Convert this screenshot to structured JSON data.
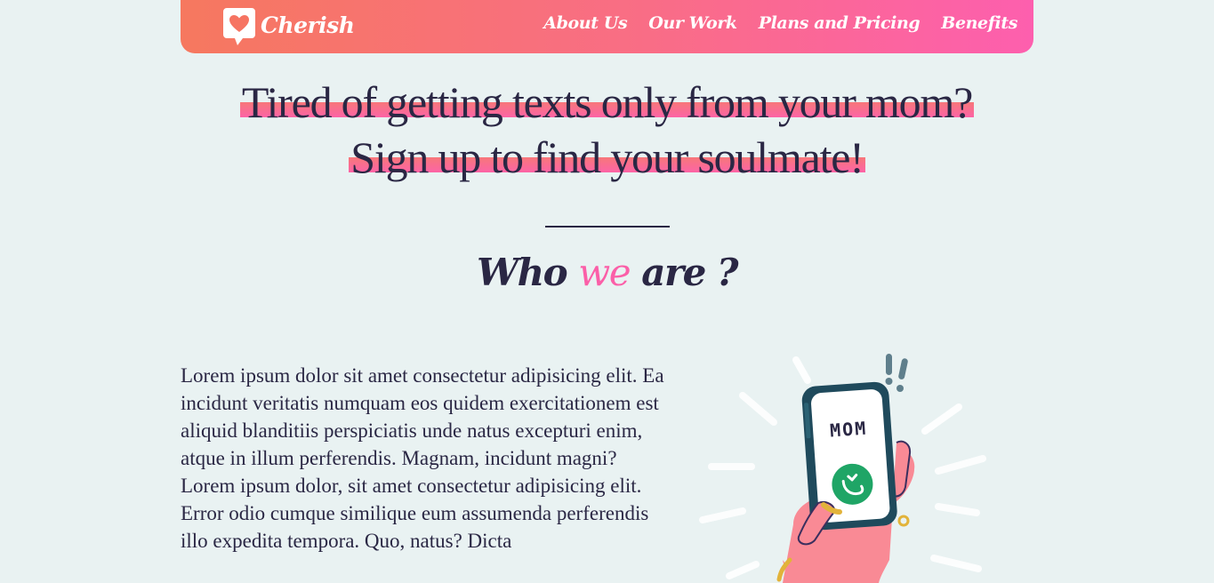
{
  "nav": {
    "brand": "Cherish",
    "links": [
      "About Us",
      "Our Work",
      "Plans and Pricing",
      "Benefits"
    ]
  },
  "hero": {
    "line1": "Tired of getting texts only from your mom?",
    "line2": "Sign up to find your soulmate!"
  },
  "section": {
    "title_pre": "Who",
    "title_accent": "we",
    "title_post": "are ?"
  },
  "about": {
    "paragraph1": "Lorem ipsum dolor sit amet consectetur adipisicing elit. Ea incidunt veritatis numquam eos quidem exercitationem est aliquid blanditiis perspiciatis unde natus excepturi enim, atque in illum perferendis. Magnam, incidunt magni?",
    "paragraph2": "Lorem ipsum dolor, sit amet consectetur adipisicing elit. Error odio cumque similique eum assumenda perferendis illo expedita tempora. Quo, natus? Dicta",
    "phone_caller": "MOM"
  },
  "colors": {
    "background": "#e9f2f2",
    "nav_gradient_start": "#f6785f",
    "nav_gradient_end": "#fd5fae",
    "text_dark": "#2a2744",
    "accent_pink": "#fb5fa8"
  },
  "icons": {
    "logo": "heart-chat-bubble-icon",
    "answer": "phone-answer-icon"
  }
}
